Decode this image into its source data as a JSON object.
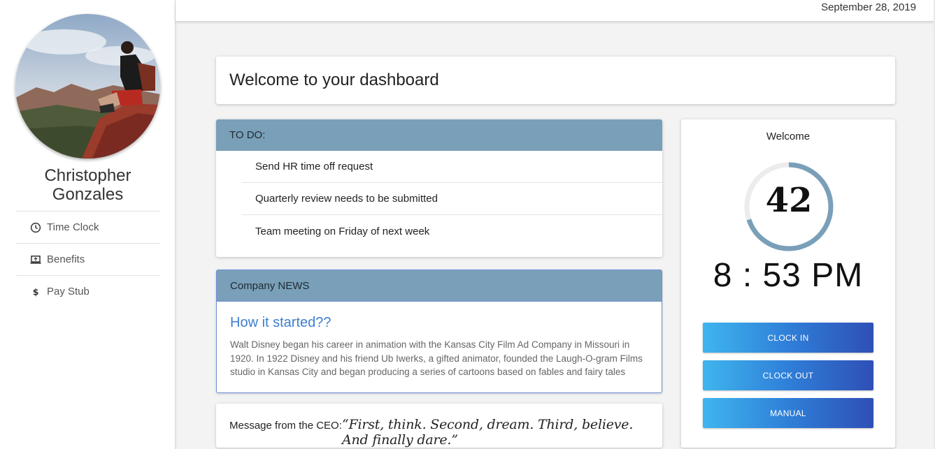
{
  "header": {
    "date": "September 28, 2019"
  },
  "user": {
    "name_line1": "Christopher",
    "name_line2": "Gonzales"
  },
  "sidebar": {
    "items": [
      {
        "label": "Time Clock",
        "icon": "clock-icon"
      },
      {
        "label": "Benefits",
        "icon": "laptop-icon"
      },
      {
        "label": "Pay Stub",
        "icon": "dollar-icon"
      }
    ]
  },
  "welcome": {
    "title": "Welcome to your dashboard"
  },
  "todo": {
    "heading": "TO DO:",
    "items": [
      "Send HR time off request",
      "Quarterly review needs to be submitted",
      "Team meeting on Friday of next week"
    ]
  },
  "news": {
    "heading": "Company NEWS",
    "title": "How it started??",
    "body": "Walt Disney began his career in animation with the Kansas City Film Ad Company in Missouri in 1920. In 1922 Disney and his friend Ub Iwerks, a gifted animator, founded the Laugh-O-gram Films studio in Kansas City and began producing a series of cartoons based on fables and fairy tales"
  },
  "ceo": {
    "label": "Message from the CEO:",
    "quote": "“First, think. Second, dream. Third, believe. And finally dare.”"
  },
  "clock": {
    "welcome": "Welcome",
    "seconds": "42",
    "seconds_progress": 0.7,
    "time": "8 : 53 PM",
    "buttons": {
      "clock_in": "CLOCK IN",
      "clock_out": "CLOCK OUT",
      "manual": "MANUAL"
    }
  },
  "colors": {
    "panel_header": "#7a9fb8",
    "ring": "#7a9fb8",
    "news_title": "#3d7fcf",
    "button_gradient_start": "#3fb5ee",
    "button_gradient_end": "#2f4fb6"
  }
}
